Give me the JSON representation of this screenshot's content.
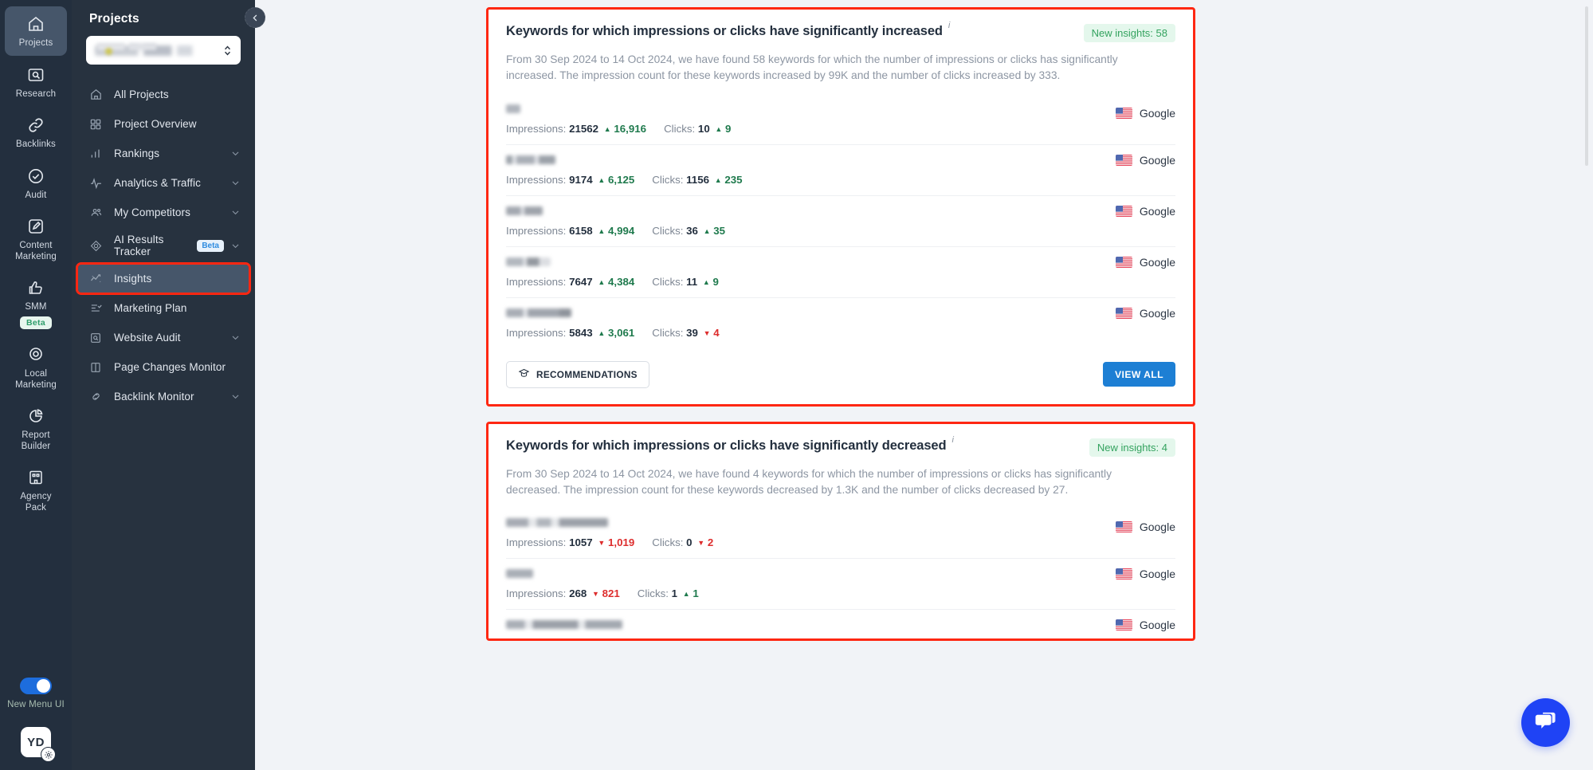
{
  "rail": {
    "items": [
      {
        "label": "Projects",
        "icon": "home-icon",
        "active": true
      },
      {
        "label": "Research",
        "icon": "magnifier-box-icon",
        "active": false
      },
      {
        "label": "Backlinks",
        "icon": "link-icon",
        "active": false
      },
      {
        "label": "Audit",
        "icon": "check-circle-icon",
        "active": false
      },
      {
        "label": "Content\nMarketing",
        "icon": "pencil-square-icon",
        "active": false
      },
      {
        "label": "SMM",
        "icon": "thumbs-up-icon",
        "badge": "Beta",
        "active": false
      },
      {
        "label": "Local\nMarketing",
        "icon": "location-pin-icon",
        "active": false
      },
      {
        "label": "Report\nBuilder",
        "icon": "pie-chart-icon",
        "active": false
      },
      {
        "label": "Agency\nPack",
        "icon": "building-icon",
        "active": false
      }
    ],
    "toggle_label": "New Menu UI",
    "avatar_initials": "YD"
  },
  "sidebar": {
    "title": "Projects",
    "project_selector_value": "",
    "items": [
      {
        "label": "All Projects",
        "icon": "home-outline-icon",
        "chevron": false
      },
      {
        "label": "Project Overview",
        "icon": "grid-icon",
        "chevron": false
      },
      {
        "label": "Rankings",
        "icon": "bar-chart-icon",
        "chevron": true
      },
      {
        "label": "Analytics & Traffic",
        "icon": "pulse-icon",
        "chevron": true
      },
      {
        "label": "My Competitors",
        "icon": "people-icon",
        "chevron": true
      },
      {
        "label": "AI Results Tracker",
        "icon": "ai-diamond-icon",
        "badge": "Beta",
        "chevron": true
      },
      {
        "label": "Insights",
        "icon": "insights-icon",
        "chevron": false,
        "active": true,
        "highlighted": true
      },
      {
        "label": "Marketing Plan",
        "icon": "checklist-icon",
        "chevron": false
      },
      {
        "label": "Website Audit",
        "icon": "magnifier-box-icon",
        "chevron": true
      },
      {
        "label": "Page Changes Monitor",
        "icon": "book-open-icon",
        "chevron": false
      },
      {
        "label": "Backlink Monitor",
        "icon": "chain-icon",
        "chevron": true
      }
    ]
  },
  "colors": {
    "highlight": "#fe2712",
    "accent_blue": "#1d7fd4",
    "up_green": "#1f7a4d",
    "down_red": "#dd2d2d",
    "pill_green": "#34a35f",
    "chat_blue": "#1f43f5"
  },
  "cards": [
    {
      "title": "Keywords for which impressions or clicks have significantly increased",
      "info_marker": "i",
      "pill": "New insights: 58",
      "description": "From 30 Sep 2024 to 14 Oct 2024, we have found 58 keywords for which the number of impressions or clicks has significantly increased. The impression count for these keywords increased by 99K and the number of clicks increased by 333.",
      "rows": [
        {
          "keyword_width": 18,
          "impressions_label": "Impressions:",
          "impressions": "21562",
          "impressions_delta": "16,916",
          "impressions_dir": "up",
          "clicks_label": "Clicks:",
          "clicks": "10",
          "clicks_delta": "9",
          "clicks_dir": "up",
          "country": "US",
          "engine": "Google"
        },
        {
          "keyword_width": 62,
          "impressions_label": "Impressions:",
          "impressions": "9174",
          "impressions_delta": "6,125",
          "impressions_dir": "up",
          "clicks_label": "Clicks:",
          "clicks": "1156",
          "clicks_delta": "235",
          "clicks_dir": "up",
          "country": "US",
          "engine": "Google"
        },
        {
          "keyword_width": 46,
          "impressions_label": "Impressions:",
          "impressions": "6158",
          "impressions_delta": "4,994",
          "impressions_dir": "up",
          "clicks_label": "Clicks:",
          "clicks": "36",
          "clicks_delta": "35",
          "clicks_dir": "up",
          "country": "US",
          "engine": "Google"
        },
        {
          "keyword_width": 56,
          "impressions_label": "Impressions:",
          "impressions": "7647",
          "impressions_delta": "4,384",
          "impressions_dir": "up",
          "clicks_label": "Clicks:",
          "clicks": "11",
          "clicks_delta": "9",
          "clicks_dir": "up",
          "country": "US",
          "engine": "Google"
        },
        {
          "keyword_width": 82,
          "impressions_label": "Impressions:",
          "impressions": "5843",
          "impressions_delta": "3,061",
          "impressions_dir": "up",
          "clicks_label": "Clicks:",
          "clicks": "39",
          "clicks_delta": "4",
          "clicks_dir": "down",
          "country": "US",
          "engine": "Google"
        }
      ],
      "recommendations_label": "RECOMMENDATIONS",
      "view_all_label": "VIEW ALL"
    },
    {
      "title": "Keywords for which impressions or clicks have significantly decreased",
      "info_marker": "i",
      "pill": "New insights: 4",
      "description": "From 30 Sep 2024 to 14 Oct 2024, we have found 4 keywords for which the number of impressions or clicks has significantly decreased. The impression count for these keywords decreased by 1.3K and the number of clicks decreased by 27.",
      "rows": [
        {
          "keyword_width": 128,
          "impressions_label": "Impressions:",
          "impressions": "1057",
          "impressions_delta": "1,019",
          "impressions_dir": "down",
          "clicks_label": "Clicks:",
          "clicks": "0",
          "clicks_delta": "2",
          "clicks_dir": "down",
          "country": "US",
          "engine": "Google"
        },
        {
          "keyword_width": 34,
          "impressions_label": "Impressions:",
          "impressions": "268",
          "impressions_delta": "821",
          "impressions_dir": "down",
          "clicks_label": "Clicks:",
          "clicks": "1",
          "clicks_delta": "1",
          "clicks_dir": "up",
          "country": "US",
          "engine": "Google"
        },
        {
          "keyword_width": 146,
          "impressions_label": "",
          "impressions": "",
          "impressions_delta": "",
          "impressions_dir": "down",
          "clicks_label": "",
          "clicks": "",
          "clicks_delta": "",
          "clicks_dir": "down",
          "country": "US",
          "engine": "Google"
        }
      ]
    }
  ]
}
